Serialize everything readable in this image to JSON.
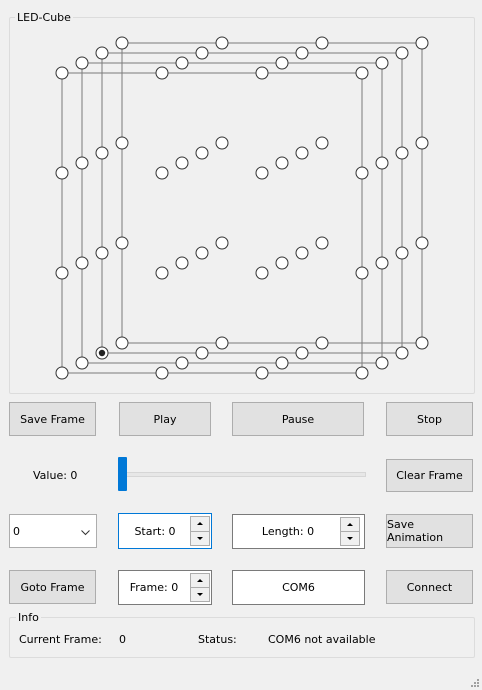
{
  "cube_group": {
    "title": "LED-Cube"
  },
  "cube": {
    "selected_led": "layer-1, bottom row, third LED"
  },
  "buttons": {
    "save_frame": "Save Frame",
    "play": "Play",
    "pause": "Pause",
    "stop": "Stop",
    "clear_frame": "Clear Frame",
    "save_animation": "Save Animation",
    "goto_frame": "Goto Frame",
    "connect": "Connect"
  },
  "slider": {
    "label": "Value: 0",
    "value": 0,
    "max": 255
  },
  "frame_select": {
    "value": "0"
  },
  "start_spin": {
    "label": "Start: 0"
  },
  "length_spin": {
    "label": "Length: 0"
  },
  "frame_spin": {
    "label": "Frame: 0"
  },
  "port_field": {
    "value": "COM6"
  },
  "info": {
    "title": "Info",
    "current_frame_label": "Current Frame:",
    "current_frame_value": "0",
    "status_label": "Status:",
    "status_value": "COM6 not available"
  },
  "colors": {
    "accent": "#0078d7",
    "button_bg": "#e1e1e1",
    "window_bg": "#f0f0f0"
  }
}
